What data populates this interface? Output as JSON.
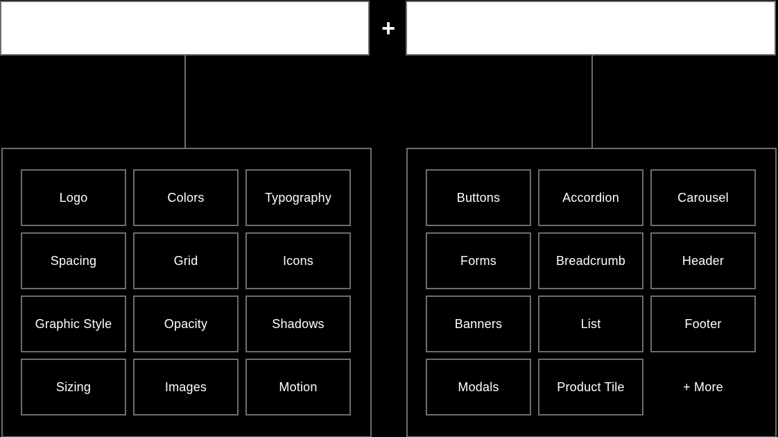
{
  "diagram": {
    "connector": {
      "symbol": "+",
      "icon_name": "plus-icon"
    },
    "header_panels": [
      {
        "id": "foundations-header",
        "label": "",
        "fill_color": "#ffffff",
        "border_color": "#6d6d6d"
      },
      {
        "id": "components-header",
        "label": "",
        "fill_color": "#ffffff",
        "border_color": "#6d6d6d"
      }
    ],
    "colors": {
      "background": "#000000",
      "border": "#6d6d6d",
      "text": "#ffffff",
      "panel_fill": "#ffffff"
    },
    "left_panel": {
      "id": "foundations-panel",
      "cells": [
        {
          "label": "Logo",
          "bordered": true
        },
        {
          "label": "Colors",
          "bordered": true
        },
        {
          "label": "Typography",
          "bordered": true
        },
        {
          "label": "Spacing",
          "bordered": true
        },
        {
          "label": "Grid",
          "bordered": true
        },
        {
          "label": "Icons",
          "bordered": true
        },
        {
          "label": "Graphic Style",
          "bordered": true
        },
        {
          "label": "Opacity",
          "bordered": true
        },
        {
          "label": "Shadows",
          "bordered": true
        },
        {
          "label": "Sizing",
          "bordered": true
        },
        {
          "label": "Images",
          "bordered": true
        },
        {
          "label": "Motion",
          "bordered": true
        }
      ]
    },
    "right_panel": {
      "id": "components-panel",
      "cells": [
        {
          "label": "Buttons",
          "bordered": true
        },
        {
          "label": "Accordion",
          "bordered": true
        },
        {
          "label": "Carousel",
          "bordered": true
        },
        {
          "label": "Forms",
          "bordered": true
        },
        {
          "label": "Breadcrumb",
          "bordered": true
        },
        {
          "label": "Header",
          "bordered": true
        },
        {
          "label": "Banners",
          "bordered": true
        },
        {
          "label": "List",
          "bordered": true
        },
        {
          "label": "Footer",
          "bordered": true
        },
        {
          "label": "Modals",
          "bordered": true
        },
        {
          "label": "Product Tile",
          "bordered": true
        },
        {
          "label": "+ More",
          "bordered": false
        }
      ]
    }
  }
}
